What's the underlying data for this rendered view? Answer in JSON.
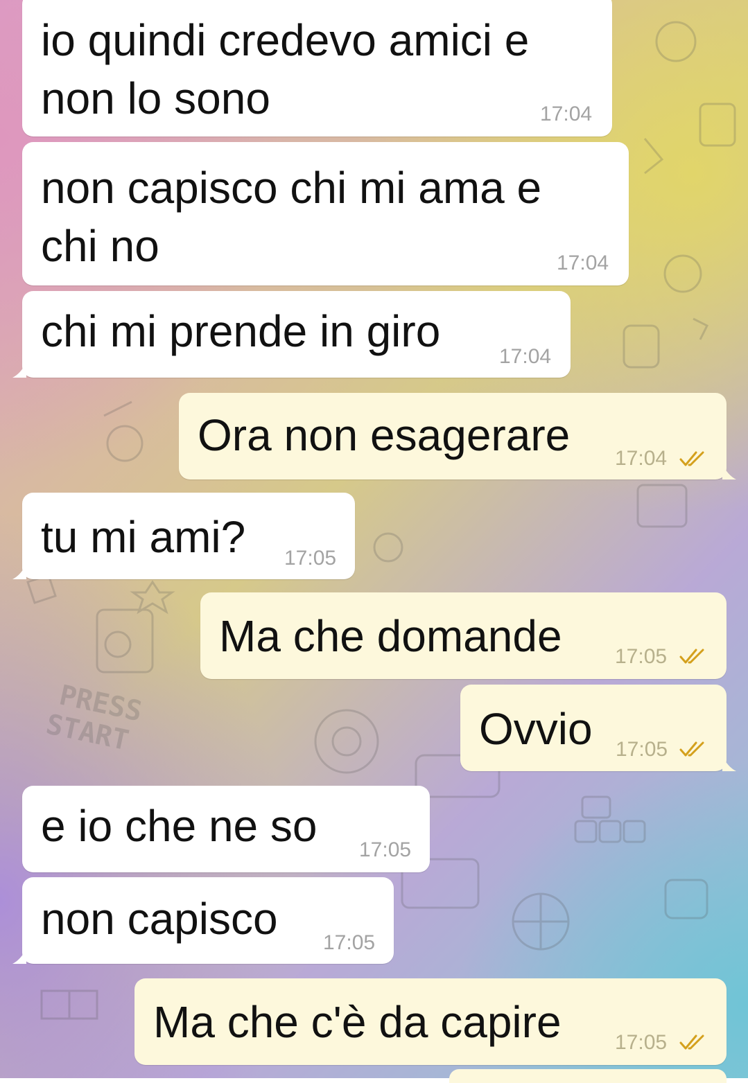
{
  "colors": {
    "incoming_bubble": "#ffffff",
    "outgoing_bubble": "#fdf8dc",
    "read_checks": "#d4a01c",
    "timestamp": "#a3a3a3"
  },
  "messages": [
    {
      "direction": "in",
      "text": "io quindi credevo amici e\nnon lo sono",
      "time": "17:04"
    },
    {
      "direction": "in",
      "text": "non capisco chi mi ama e\nchi no",
      "time": "17:04"
    },
    {
      "direction": "in",
      "text": "chi mi prende in giro",
      "time": "17:04"
    },
    {
      "direction": "out",
      "text": "Ora non esagerare",
      "time": "17:04",
      "status": "read-double-check-icon"
    },
    {
      "direction": "in",
      "text": "tu mi ami?",
      "time": "17:05"
    },
    {
      "direction": "out",
      "text": "Ma che domande",
      "time": "17:05",
      "status": "read-double-check-icon"
    },
    {
      "direction": "out",
      "text": "Ovvio",
      "time": "17:05",
      "status": "read-double-check-icon"
    },
    {
      "direction": "in",
      "text": "e io che ne so",
      "time": "17:05"
    },
    {
      "direction": "in",
      "text": "non capisco",
      "time": "17:05"
    },
    {
      "direction": "out",
      "text": "Ma che c'è da capire",
      "time": "17:05",
      "status": "read-double-check-icon"
    }
  ],
  "wallpaper_lettering": "PRESS START"
}
